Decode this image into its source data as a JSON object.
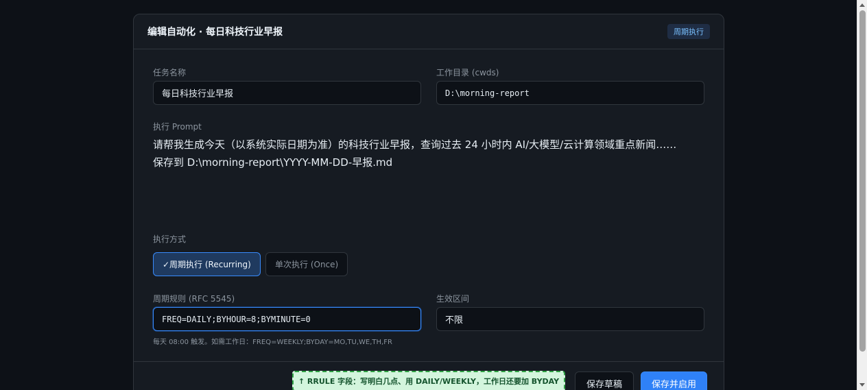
{
  "header": {
    "title": "编辑自动化 · 每日科技行业早报",
    "badge": "周期执行"
  },
  "fields": {
    "name_label": "任务名称",
    "name_value": "每日科技行业早报",
    "cwd_label": "工作目录 (cwds)",
    "cwd_value": "D:\\morning-report",
    "prompt_label": "执行 Prompt",
    "prompt_line1": "请帮我生成今天（以系统实际日期为准）的科技行业早报，查询过去 24 小时内 AI/大模型/云计算领域重点新闻……",
    "prompt_line2": "保存到 D:\\morning-report\\YYYY-MM-DD-早报.md",
    "mode_label": "执行方式",
    "mode_recurring": "✓周期执行 (Recurring)",
    "mode_once": "单次执行 (Once)",
    "rrule_label": "周期规则 (RFC 5545)",
    "rrule_value": "FREQ=DAILY;BYHOUR=8;BYMINUTE=0",
    "range_label": "生效区间",
    "range_value": "不限",
    "rrule_hint": "每天 08:00 触发。如需工作日：FREQ=WEEKLY;BYDAY=MO,TU,WE,TH,FR"
  },
  "footer": {
    "callout": "↑ RRULE 字段：写明白几点、用 DAILY/WEEKLY，工作日还要加 BYDAY",
    "save_draft": "保存草稿",
    "save_enable": "保存并启用"
  }
}
